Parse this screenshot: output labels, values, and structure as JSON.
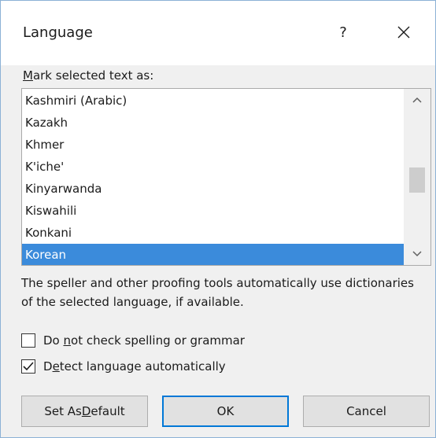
{
  "dialog": {
    "title": "Language",
    "help_label": "?",
    "close_icon": "close-icon"
  },
  "list": {
    "label_mnemonic": "M",
    "label_rest": "ark selected text as:",
    "items": [
      {
        "label": "Kashmiri (Arabic)"
      },
      {
        "label": "Kazakh"
      },
      {
        "label": "Khmer"
      },
      {
        "label": "K'iche'"
      },
      {
        "label": "Kinyarwanda"
      },
      {
        "label": "Kiswahili"
      },
      {
        "label": "Konkani"
      },
      {
        "label": "Korean"
      }
    ],
    "selected_value": "Korean"
  },
  "description": "The speller and other proofing tools automatically use dictionaries of the selected language, if available.",
  "options": {
    "no_check": {
      "label_pre": "Do ",
      "label_mnemonic": "n",
      "label_post": "ot check spelling or grammar",
      "checked": false
    },
    "detect": {
      "label_pre": "D",
      "label_mnemonic": "e",
      "label_post": "tect language automatically",
      "checked": true
    }
  },
  "buttons": {
    "set_default_pre": "Set As ",
    "set_default_mnemonic": "D",
    "set_default_post": "efault",
    "ok": "OK",
    "cancel": "Cancel"
  },
  "colors": {
    "selection": "#3b8bdb",
    "accent": "#0078d7"
  }
}
